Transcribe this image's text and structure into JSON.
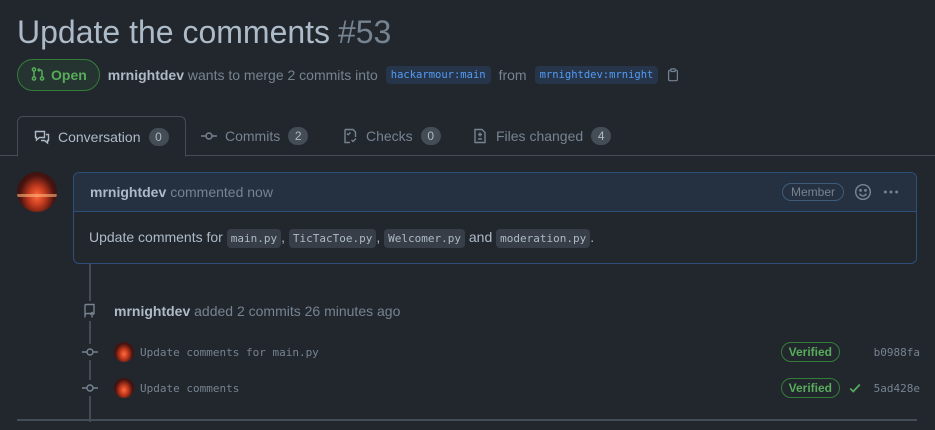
{
  "pr": {
    "title": "Update the comments",
    "number": "#53",
    "state": "Open",
    "author": "mrnightdev",
    "merge_text": "wants to merge 2 commits into",
    "base_branch": "hackarmour:main",
    "from_text": "from",
    "head_branch": "mrnightdev:mrnight"
  },
  "tabs": [
    {
      "label": "Conversation",
      "count": "0"
    },
    {
      "label": "Commits",
      "count": "2"
    },
    {
      "label": "Checks",
      "count": "0"
    },
    {
      "label": "Files changed",
      "count": "4"
    }
  ],
  "comment": {
    "author": "mrnightdev",
    "time": "commented now",
    "role": "Member",
    "body_prefix": "Update comments for",
    "files": [
      "main.py",
      "TicTacToe.py",
      "Welcomer.py",
      "moderation.py"
    ],
    "sep1": ",",
    "sep2": ",",
    "and_text": "and",
    "end": "."
  },
  "event": {
    "author": "mrnightdev",
    "text": "added 2 commits",
    "time": "26 minutes ago"
  },
  "commits": [
    {
      "message": "Update comments for main.py",
      "verified": "Verified",
      "sha": "b0988fa"
    },
    {
      "message": "Update comments",
      "verified": "Verified",
      "sha": "5ad428e"
    }
  ],
  "colors": {
    "background": "#22272e",
    "accent_green": "#57ab5a",
    "link_blue": "#539bf5"
  }
}
